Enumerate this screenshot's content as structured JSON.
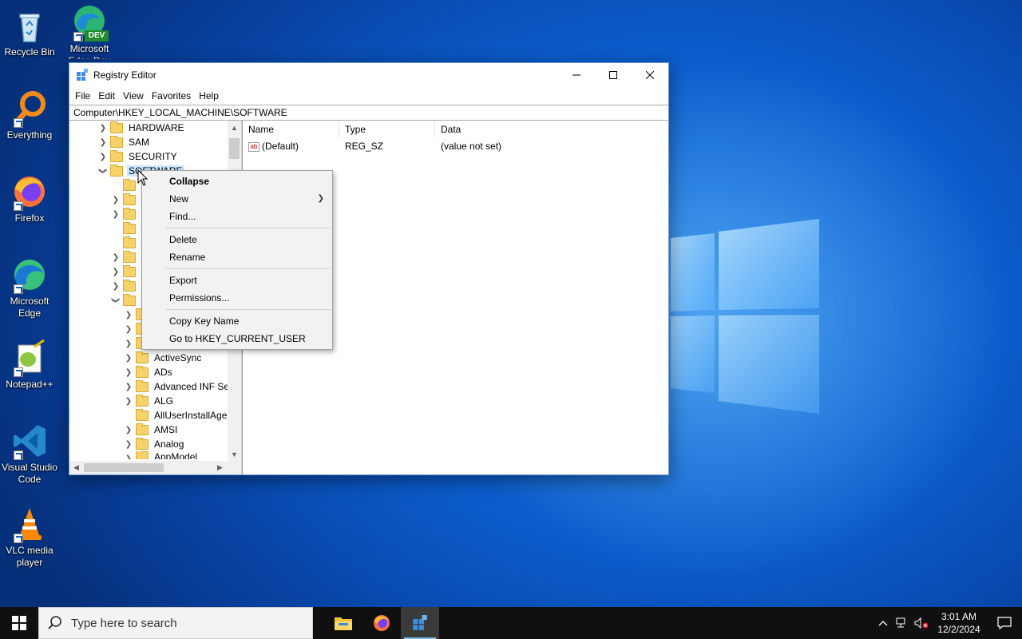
{
  "desktop": {
    "icons": [
      {
        "label": "Recycle Bin",
        "icon": "recycle-bin-icon"
      },
      {
        "label": "Microsoft Edge Dev",
        "badge": "DEV",
        "icon": "edge-dev-icon"
      },
      {
        "label": "Everything",
        "icon": "everything-search-icon"
      },
      {
        "label": "Firefox",
        "icon": "firefox-icon"
      },
      {
        "label": "Microsoft Edge",
        "icon": "edge-icon"
      },
      {
        "label": "Notepad++",
        "icon": "notepadpp-icon"
      },
      {
        "label": "Visual Studio Code",
        "icon": "vscode-icon"
      },
      {
        "label": "VLC media player",
        "icon": "vlc-icon"
      }
    ]
  },
  "window": {
    "title": "Registry Editor",
    "menu": [
      "File",
      "Edit",
      "View",
      "Favorites",
      "Help"
    ],
    "address": "Computer\\HKEY_LOCAL_MACHINE\\SOFTWARE",
    "tree": {
      "top_keys": [
        "HARDWARE",
        "SAM",
        "SECURITY",
        "SOFTWARE"
      ],
      "sub_keys": [
        "ActiveSync",
        "ADs",
        "Advanced INF Set",
        "ALG",
        "AllUserInstallAgen",
        "AMSI",
        "Analog",
        "AppModel"
      ]
    },
    "list": {
      "columns": [
        "Name",
        "Type",
        "Data"
      ],
      "rows": [
        {
          "name": "(Default)",
          "type": "REG_SZ",
          "data": "(value not set)"
        }
      ]
    }
  },
  "context_menu": {
    "items": [
      "Collapse",
      "New",
      "Find...",
      "Delete",
      "Rename",
      "Export",
      "Permissions...",
      "Copy Key Name",
      "Go to HKEY_CURRENT_USER"
    ]
  },
  "taskbar": {
    "search_placeholder": "Type here to search",
    "time": "3:01 AM",
    "date": "12/2/2024"
  },
  "colors": {
    "selection": "#cce8ff",
    "taskbar": "#101010",
    "accent": "#76b9ed"
  }
}
